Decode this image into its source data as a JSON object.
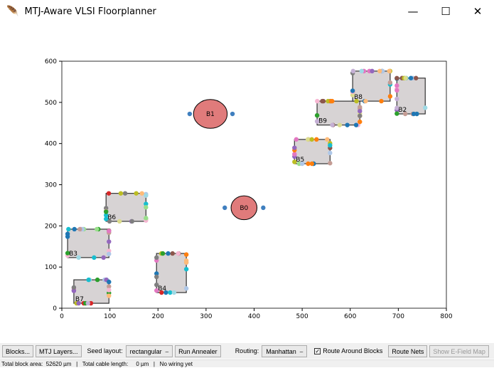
{
  "window": {
    "title": "MTJ-Aware VLSI Floorplanner",
    "icon": "feather-icon"
  },
  "toolbar": {
    "blocks": "Blocks...",
    "mtj_layers": "MTJ Layers...",
    "seed_label": "Seed layout:",
    "seed_value": "rectangular",
    "run": "Run Annealer",
    "routing_label": "Routing:",
    "routing_value": "Manhattan",
    "route_around": "Route Around Blocks",
    "route_around_checked": true,
    "route_nets": "Route Nets",
    "efield": "Show E-Field Map"
  },
  "status": {
    "text": "Total block area:  52620 µm   |   Total cable length:     0 µm   |   No wiring yet"
  },
  "chart_data": {
    "type": "scatter",
    "xlim": [
      0,
      800
    ],
    "ylim": [
      0,
      600
    ],
    "xticks": [
      "0",
      "100",
      "200",
      "300",
      "400",
      "500",
      "600",
      "700",
      "800"
    ],
    "yticks": [
      "0",
      "100",
      "200",
      "300",
      "400",
      "500",
      "600"
    ],
    "blocks": [
      {
        "name": "B7",
        "x0": 25,
        "y0": 12,
        "x1": 98,
        "y1": 69
      },
      {
        "name": "B3",
        "x0": 12,
        "y0": 123,
        "x1": 98,
        "y1": 192
      },
      {
        "name": "B6",
        "x0": 92,
        "y0": 211,
        "x1": 175,
        "y1": 279
      },
      {
        "name": "B4",
        "x0": 197,
        "y0": 38,
        "x1": 259,
        "y1": 133
      },
      {
        "name": "B5",
        "x0": 484,
        "y0": 351,
        "x1": 558,
        "y1": 410
      },
      {
        "name": "B9",
        "x0": 531,
        "y0": 445,
        "x1": 620,
        "y1": 503
      },
      {
        "name": "B8",
        "x0": 605,
        "y0": 503,
        "x1": 683,
        "y1": 576
      },
      {
        "name": "B2",
        "x0": 697,
        "y0": 472,
        "x1": 756,
        "y1": 559
      }
    ],
    "mtj": [
      {
        "name": "B1",
        "cx": 309,
        "cy": 472,
        "rx": 35,
        "ry": 35,
        "pins": [
          [
            266,
            472
          ],
          [
            355,
            472
          ]
        ]
      },
      {
        "name": "B0",
        "cx": 379,
        "cy": 244,
        "rx": 27,
        "ry": 29,
        "pins": [
          [
            339,
            244
          ],
          [
            419,
            244
          ]
        ]
      }
    ],
    "block_fill": "#d7d3d4",
    "mtj_fill": "#e07b7b",
    "pin_color": "#3f7fbf"
  }
}
